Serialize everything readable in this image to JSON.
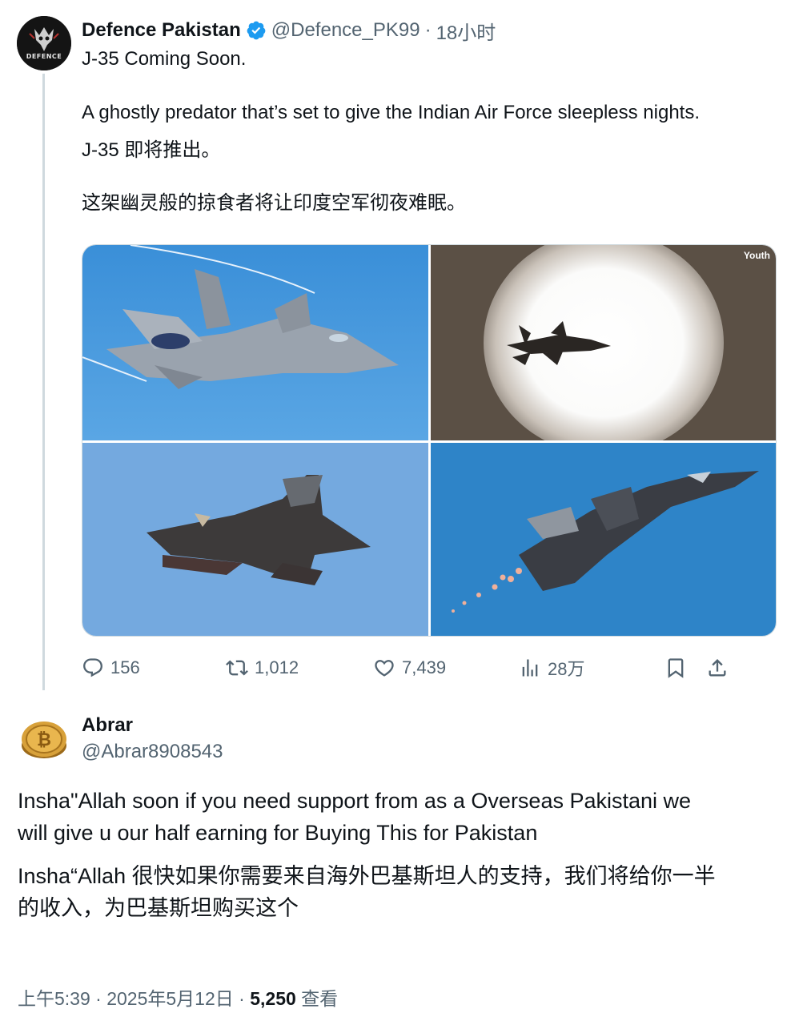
{
  "post": {
    "author_name": "Defence Pakistan",
    "handle": "@Defence_PK99",
    "separator": "·",
    "time": "18小时",
    "avatar_text": "DEFENCE",
    "text_lines": [
      "J-35 Coming Soon.",
      "A ghostly predator that’s set to give the Indian Air Force sleepless nights.",
      "J-35 即将推出。",
      "这架幽灵般的掠食者将让印度空军彻夜难眠。"
    ],
    "media_watermark": "Youth",
    "actions": {
      "reply_icon": "reply-icon",
      "replies": "156",
      "retweet_icon": "retweet-icon",
      "retweets": "1,012",
      "like_icon": "heart-icon",
      "likes": "7,439",
      "views_icon": "views-icon",
      "views": "28万",
      "bookmark_icon": "bookmark-icon",
      "share_icon": "share-icon"
    }
  },
  "reply": {
    "author_name": "Abrar",
    "handle": "@Abrar8908543",
    "text_lines": [
      "Insha\"Allah soon if you need  support from as a Overseas Pakistani we",
      "will give u our half earning for Buying This for Pakistan",
      "Insha“Allah 很快如果你需要来自海外巴基斯坦人的支持，我们将给你一半",
      "的收入，为巴基斯坦购买这个"
    ],
    "footer": {
      "time": "上午5:39",
      "separator": "·",
      "date": "2025年5月12日",
      "separator2": "·",
      "views_count": "5,250",
      "views_label": "查看"
    }
  },
  "colors": {
    "verified_blue": "#1d9bf0",
    "secondary_text": "#536471",
    "primary_text": "#0f1419",
    "thread_line": "#cfd9de"
  }
}
